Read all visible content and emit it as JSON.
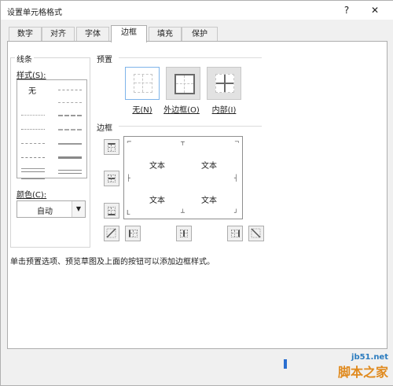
{
  "window": {
    "title": "设置单元格格式",
    "help_icon": "?",
    "close_icon": "✕"
  },
  "tabs": [
    {
      "label": "数字"
    },
    {
      "label": "对齐"
    },
    {
      "label": "字体"
    },
    {
      "label": "边框"
    },
    {
      "label": "填充"
    },
    {
      "label": "保护"
    }
  ],
  "active_tab": "边框",
  "line": {
    "group_label": "线条",
    "style_label": "样式(S):",
    "none_label": "无",
    "color_label": "颜色(C):",
    "color_value": "自动"
  },
  "presets": {
    "section_label": "预置",
    "items": [
      {
        "label": "无(N)"
      },
      {
        "label": "外边框(O)"
      },
      {
        "label": "内部(I)"
      }
    ]
  },
  "border": {
    "section_label": "边框",
    "preview_text": [
      "文本",
      "文本",
      "文本",
      "文本"
    ]
  },
  "hint_text": "单击预置选项、预览草图及上面的按钮可以添加边框样式。",
  "watermark": {
    "line1": "jb51.net",
    "line2": "脚本之家"
  },
  "colors": {
    "accent": "#7eb4ea",
    "dialog_bg": "#f0f0f0",
    "panel_bg": "#ffffff"
  }
}
